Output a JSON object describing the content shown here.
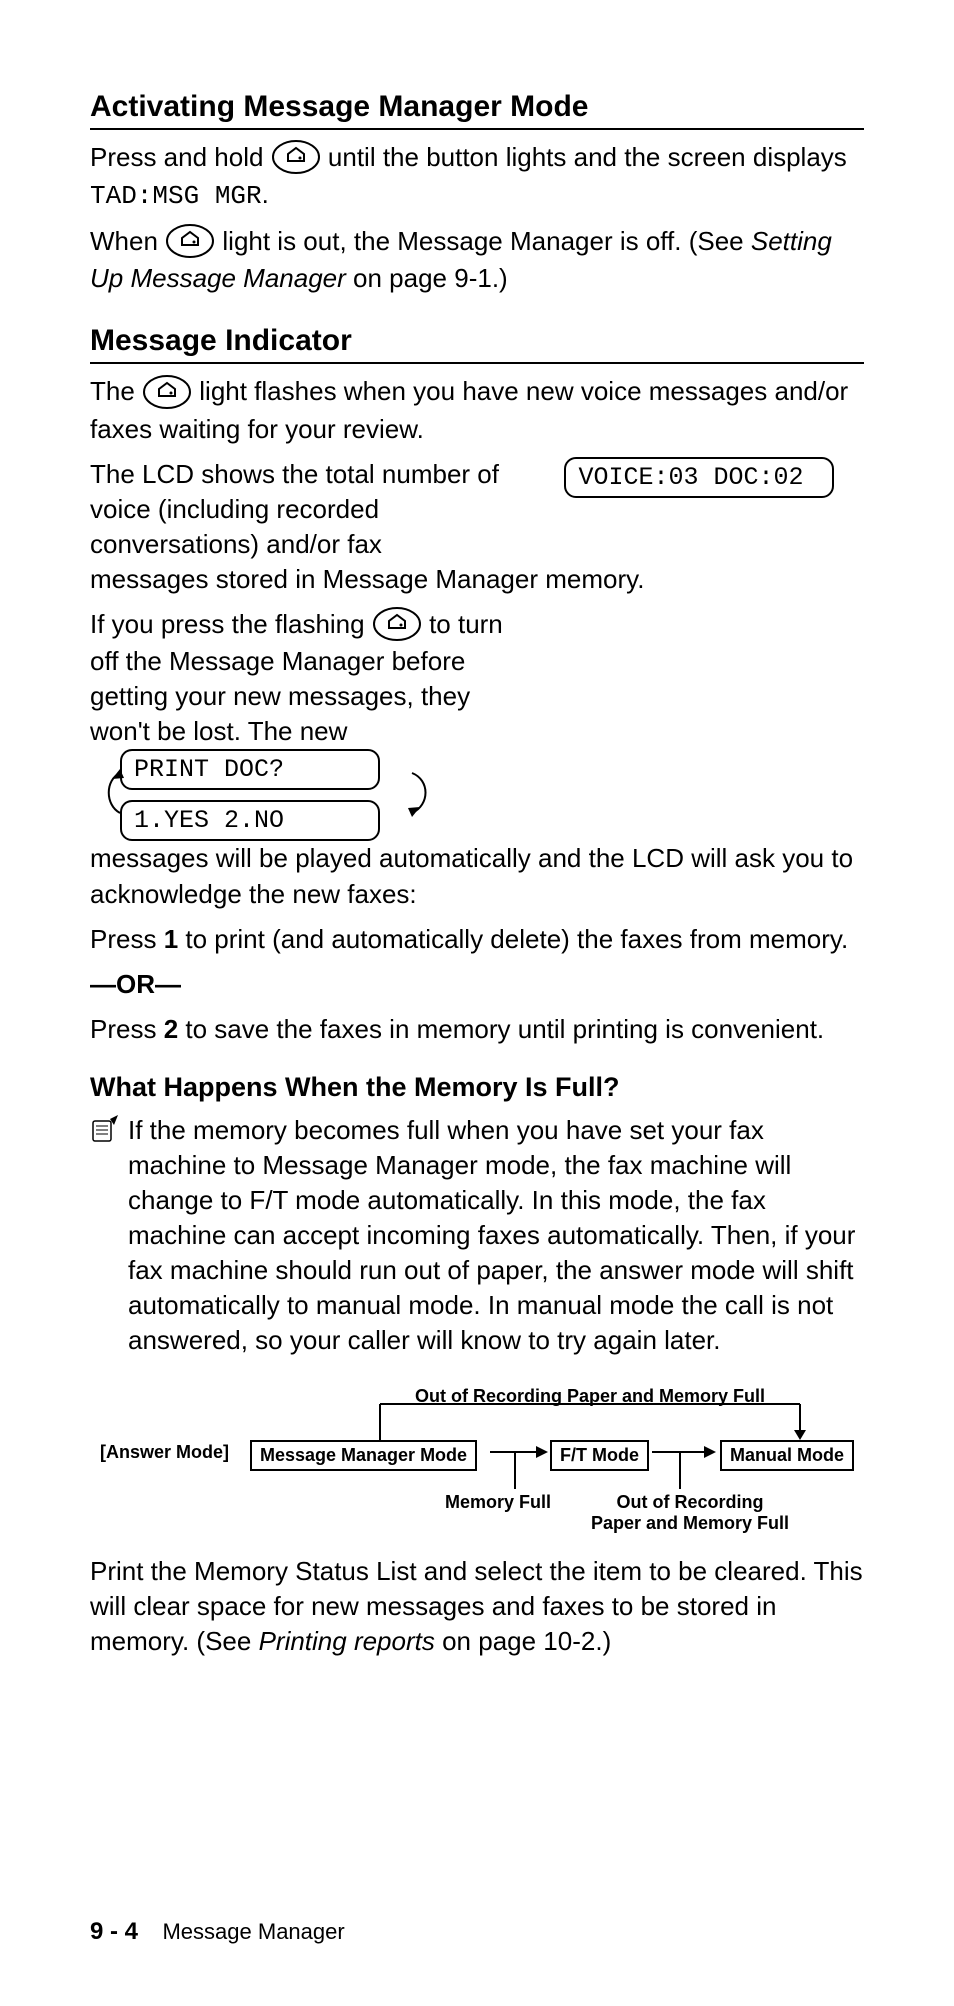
{
  "sections": {
    "activating": {
      "heading": "Activating Message Manager Mode",
      "line1a": "Press and hold ",
      "line1b": " until the button lights and the screen displays ",
      "tad": "TAD:MSG MGR",
      "dot1": ".",
      "line2a": "When ",
      "line2b": " light is out, the Message Manager is off. (See ",
      "line2c": "Setting Up Message Manager",
      "line2d": " on page 9-1.)"
    },
    "indicator": {
      "heading": "Message Indicator",
      "p1a": "The ",
      "p1b": " light flashes when you have new voice messages and/or faxes waiting for your review.",
      "p2": "The LCD shows the total number of voice (including recorded conversations) and/or fax messages stored in Message Manager memory.",
      "lcd_voice": "VOICE:03 DOC:02",
      "p3a": "If you press the flashing ",
      "p3b": " to turn off the Message Manager before getting your new messages, they won't be lost. The new messages will be played automatically and the LCD will ask you to acknowledge the new faxes:",
      "lcd_print": "PRINT DOC?",
      "lcd_yesno": "1.YES 2.NO",
      "p4a": "Press ",
      "p4b": "1",
      "p4c": " to print (and automatically delete) the faxes from memory.",
      "or": "—OR—",
      "p5a": "Press ",
      "p5b": "2",
      "p5c": " to save the faxes in memory until printing is convenient."
    },
    "full": {
      "heading": "What Happens When the Memory Is Full?",
      "note": "If the memory becomes full when you have set your fax machine to Message Manager mode, the fax machine will change to F/T mode automatically. In this mode, the fax machine can accept incoming faxes automatically. Then, if your fax machine should run out of paper, the answer mode will shift automatically to manual mode. In manual mode the call is not answered, so your caller will know to try again later.",
      "flow": {
        "top_label": "Out of Recording Paper and Memory Full",
        "answer_mode": "[Answer Mode]",
        "box1": "Message Manager Mode",
        "box2": "F/T Mode",
        "box3": "Manual Mode",
        "mem_full": "Memory Full",
        "out_paper_mem": "Out of Recording Paper and Memory Full"
      },
      "p_after_a": "Print the Memory Status List and select the item to be cleared. This will clear space for new messages and faxes to be stored in memory. (See ",
      "p_after_b": "Printing reports",
      "p_after_c": " on page 10-2.)"
    }
  },
  "footer": {
    "page": "9 - 4",
    "title": "Message Manager"
  }
}
